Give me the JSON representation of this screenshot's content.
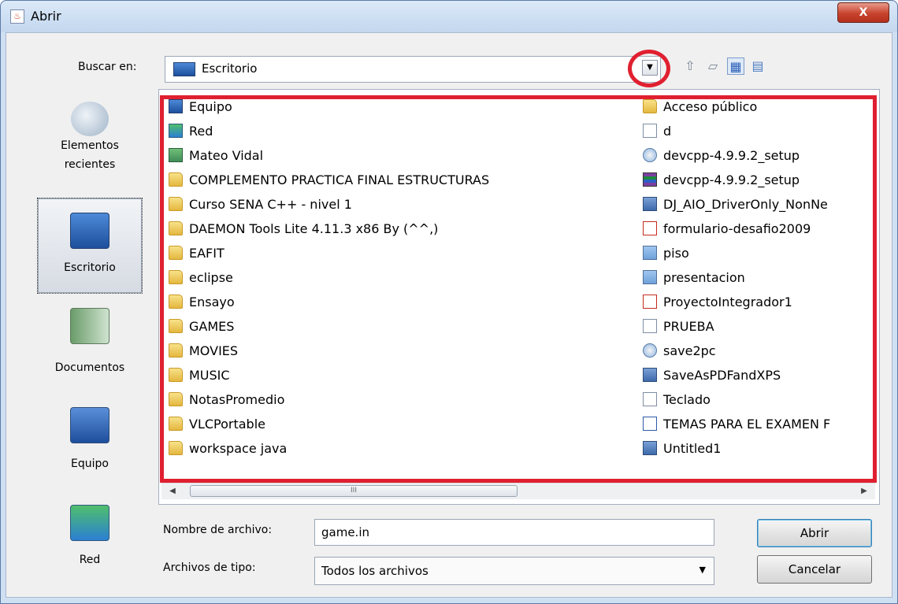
{
  "window": {
    "title": "Abrir",
    "close_label": "X"
  },
  "lookin": {
    "label": "Buscar en:",
    "value": "Escritorio"
  },
  "places": [
    {
      "label": "Elementos recientes"
    },
    {
      "label": "Escritorio"
    },
    {
      "label": "Documentos"
    },
    {
      "label": "Equipo"
    },
    {
      "label": "Red"
    }
  ],
  "files_left": [
    {
      "name": "Equipo",
      "icon": "monitor"
    },
    {
      "name": "Red",
      "icon": "net"
    },
    {
      "name": "Mateo Vidal",
      "icon": "user"
    },
    {
      "name": "COMPLEMENTO PRACTICA FINAL ESTRUCTURAS",
      "icon": "folder"
    },
    {
      "name": "Curso SENA C++ - nivel 1",
      "icon": "folder"
    },
    {
      "name": "DAEMON Tools Lite 4.11.3 x86 By  (^^,)",
      "icon": "folder"
    },
    {
      "name": "EAFIT",
      "icon": "folder"
    },
    {
      "name": "eclipse",
      "icon": "folder"
    },
    {
      "name": "Ensayo",
      "icon": "folder"
    },
    {
      "name": "GAMES",
      "icon": "folder"
    },
    {
      "name": "MOVIES",
      "icon": "folder"
    },
    {
      "name": "MUSIC",
      "icon": "folder"
    },
    {
      "name": "NotasPromedio",
      "icon": "folder"
    },
    {
      "name": "VLCPortable",
      "icon": "folder"
    },
    {
      "name": "workspace java",
      "icon": "folder"
    }
  ],
  "files_right": [
    {
      "name": "Acceso público",
      "icon": "folder"
    },
    {
      "name": "d",
      "icon": "file"
    },
    {
      "name": "devcpp-4.9.9.2_setup",
      "icon": "setup"
    },
    {
      "name": "devcpp-4.9.9.2_setup",
      "icon": "rar"
    },
    {
      "name": "DJ_AIO_DriverOnly_NonNe",
      "icon": "app"
    },
    {
      "name": "formulario-desafio2009",
      "icon": "pdf"
    },
    {
      "name": "piso",
      "icon": "img"
    },
    {
      "name": "presentacion",
      "icon": "img"
    },
    {
      "name": "ProyectoIntegrador1",
      "icon": "pdf"
    },
    {
      "name": "PRUEBA",
      "icon": "file"
    },
    {
      "name": "save2pc",
      "icon": "setup"
    },
    {
      "name": "SaveAsPDFandXPS",
      "icon": "app"
    },
    {
      "name": "Teclado",
      "icon": "file"
    },
    {
      "name": "TEMAS PARA EL EXAMEN F",
      "icon": "word"
    },
    {
      "name": "Untitled1",
      "icon": "app"
    }
  ],
  "scrollbar": {
    "left_arrow": "◀",
    "right_arrow": "▶",
    "grip": "III"
  },
  "filename": {
    "label": "Nombre de archivo:",
    "value": "game.in"
  },
  "filetype": {
    "label": "Archivos de tipo:",
    "value": "Todos los archivos"
  },
  "buttons": {
    "open": "Abrir",
    "cancel": "Cancelar"
  },
  "highlight_color": "#e02030"
}
